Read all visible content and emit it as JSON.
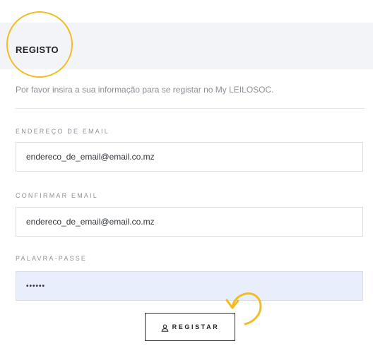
{
  "header": {
    "title": "REGISTO"
  },
  "intro_text": "Por favor insira a sua informação para se registar no My LEILOSOC.",
  "form": {
    "email": {
      "label": "ENDEREÇO DE EMAIL",
      "value": "endereco_de_email@email.co.mz"
    },
    "confirm_email": {
      "label": "CONFIRMAR EMAIL",
      "value": "endereco_de_email@email.co.mz"
    },
    "password": {
      "label": "PALAVRA-PASSE",
      "value": "••••••"
    },
    "submit": {
      "label": "REGISTAR",
      "icon": "user-icon"
    }
  },
  "colors": {
    "annotation": "#f2bc23",
    "header_band": "#f3f4f7",
    "autofill": "#e8eefc",
    "text_dark": "#1f2226"
  }
}
